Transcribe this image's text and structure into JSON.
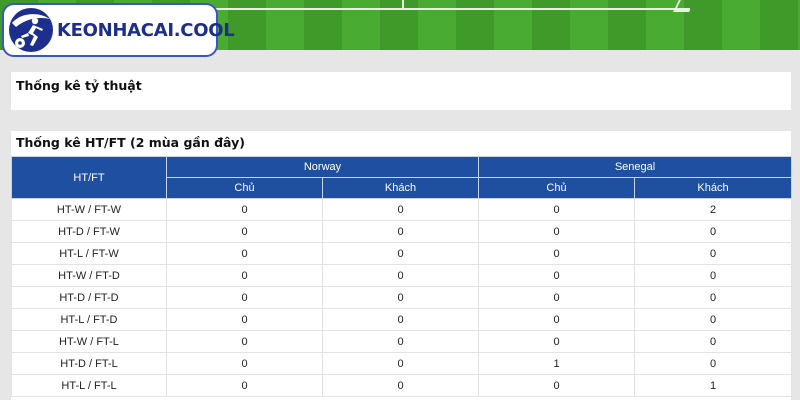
{
  "brand": {
    "logo_text": "KEONHACAI.COOL"
  },
  "sections": {
    "odds_title": "Thống kê tỷ thuật",
    "htft_title": "Thống kê HT/FT (2 mùa gần đây)"
  },
  "table": {
    "first_header": "HT/FT",
    "teams": [
      "Norway",
      "Senegal"
    ],
    "sub_headers": [
      "Chủ",
      "Khách",
      "Chủ",
      "Khách"
    ],
    "rows": [
      {
        "label": "HT-W / FT-W",
        "values": [
          "0",
          "0",
          "0",
          "2"
        ]
      },
      {
        "label": "HT-D / FT-W",
        "values": [
          "0",
          "0",
          "0",
          "0"
        ]
      },
      {
        "label": "HT-L / FT-W",
        "values": [
          "0",
          "0",
          "0",
          "0"
        ]
      },
      {
        "label": "HT-W / FT-D",
        "values": [
          "0",
          "0",
          "0",
          "0"
        ]
      },
      {
        "label": "HT-D / FT-D",
        "values": [
          "0",
          "0",
          "0",
          "0"
        ]
      },
      {
        "label": "HT-L / FT-D",
        "values": [
          "0",
          "0",
          "0",
          "0"
        ]
      },
      {
        "label": "HT-W / FT-L",
        "values": [
          "0",
          "0",
          "0",
          "0"
        ]
      },
      {
        "label": "HT-D / FT-L",
        "values": [
          "0",
          "0",
          "1",
          "0"
        ]
      },
      {
        "label": "HT-L / FT-L",
        "values": [
          "0",
          "0",
          "0",
          "1"
        ]
      }
    ]
  },
  "colors": {
    "header_blue": "#1e4fa1",
    "logo_blue": "#1c2f8c",
    "grass": "#3f9a2a"
  },
  "icons": {
    "logo": "soccer-player-ball-icon"
  }
}
